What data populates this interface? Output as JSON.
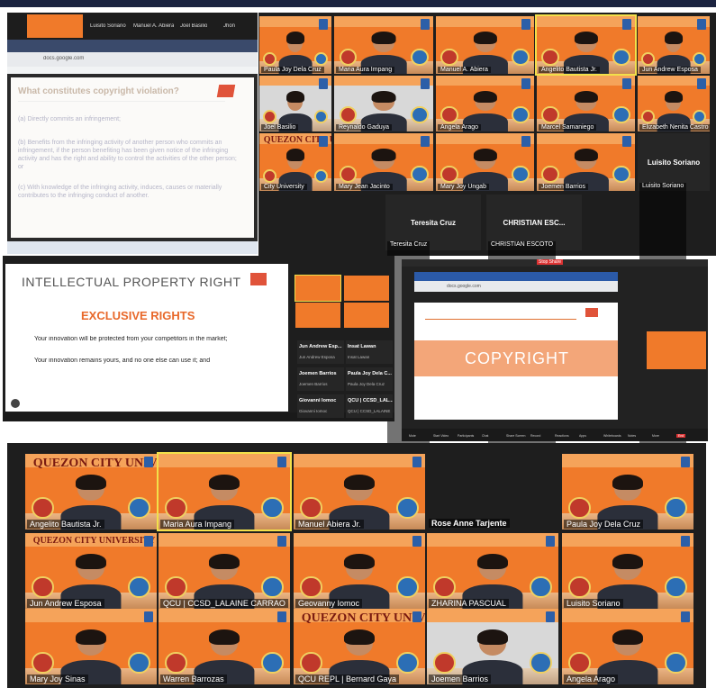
{
  "colors": {
    "orange": "#f07a2a",
    "dark": "#1e1e1e",
    "accent_blue": "#2c5fa8",
    "copyright_band": "#f3a679",
    "slide_red": "#e0533a"
  },
  "top_left_window": {
    "browser_url": "docs.google.com",
    "heading": "What constitutes copyright violation?",
    "items": [
      "(a) Directly commits an infringement;",
      "(b) Benefits from the infringing activity of another person who commits an infringement, if the person benefiting has been given notice of the infringing activity and has the right and ability to control the activities of the other person; or",
      "(c) With knowledge of the infringing activity, induces, causes or materially contributes to the infringing conduct of another."
    ],
    "top_strip_names": [
      "Luisito Soriano",
      "Manuel A. Abiera",
      "Joel Basilio",
      "Jhon"
    ]
  },
  "top_right_grid": {
    "university": "QUEZON CITY UNIVERSITY",
    "tiles": [
      {
        "name": "Paula Joy Dela Cruz"
      },
      {
        "name": "Maria Aura Impang"
      },
      {
        "name": "Manuel A. Abiera"
      },
      {
        "name": "Angelito Bautista Jr."
      },
      {
        "name": "Jun Andrew Esposa"
      },
      {
        "name": "Joel Basilio"
      },
      {
        "name": "Reynaldo Gaduya"
      },
      {
        "name": "Angela Arago"
      },
      {
        "name": "Marcel Samaniego"
      },
      {
        "name": "Elizabeth Nenita Castro"
      },
      {
        "name": "City University"
      },
      {
        "name": "Mary Jean Jacinto"
      },
      {
        "name": "Mary Joy Ungab"
      },
      {
        "name": "Joemen Barrios"
      },
      {
        "name": "Luisito Soriano"
      },
      {
        "name": "Teresita Cruz"
      },
      {
        "name": "CHRISTIAN ESCOTO"
      }
    ],
    "dark_tiles": [
      {
        "label": "Luisito Soriano",
        "name": "Luisito Soriano"
      },
      {
        "label": "Teresita Cruz",
        "name": "Teresita Cruz"
      },
      {
        "label": "CHRISTIAN ESC...",
        "name": "CHRISTIAN ESCOTO"
      }
    ]
  },
  "middle_left_slide": {
    "title": "INTELLECTUAL PROPERTY RIGHT",
    "subtitle": "EXCLUSIVE RIGHTS",
    "line1": "Your innovation will be protected from your competitors in the market;",
    "line2": "Your innovation remains yours, and no one else can use it; and"
  },
  "middle_side_panel": {
    "participants": [
      {
        "label": "Jun Andrew Esp...",
        "name": "Jun Andrew Esposa"
      },
      {
        "label": "Insat Lawan",
        "name": "Insat Lawan"
      },
      {
        "label": "Joemen Barrios",
        "name": "Joemen Barrios"
      },
      {
        "label": "Paula Joy Dela C...",
        "name": "Paula Joy Dela Cruz"
      },
      {
        "label": "Giovanni Iomoc",
        "name": "Giovanni Iomoc"
      },
      {
        "label": "QCU | CCSD_LAL...",
        "name": "QCU | CCSD_LALAINE"
      }
    ]
  },
  "middle_right_window": {
    "url": "docs.google.com",
    "share_label": "Stop Share",
    "slide_word": "COPYRIGHT",
    "toolbar_items": [
      "Mute",
      "Start Video",
      "Participants",
      "Chat",
      "Share Screen",
      "Record",
      "Reactions",
      "Apps",
      "Whiteboards",
      "Notes",
      "More",
      "End"
    ]
  },
  "bottom_grid": {
    "university": "QUEZON CITY UNIVERSITY",
    "tiles": [
      {
        "name": "Angelito Bautista Jr."
      },
      {
        "name": "Maria Aura Impang"
      },
      {
        "name": "Manuel Abiera Jr."
      },
      {
        "name": "Rose Anne Tarjente"
      },
      {
        "name": "Paula Joy Dela Cruz"
      },
      {
        "name": "Jun Andrew Esposa"
      },
      {
        "name": "QCU | CCSD_LALAINE CARRAO"
      },
      {
        "name": "Geovanny Iomoc"
      },
      {
        "name": "ZHARINA PASCUAL"
      },
      {
        "name": "Luisito Soriano"
      },
      {
        "name": "Mary Joy Sinas"
      },
      {
        "name": "Warren Barrozas"
      },
      {
        "name": "QCU REPL | Bernard Gaya"
      },
      {
        "name": "Joemen Barrios"
      },
      {
        "name": "Angela Arago"
      }
    ]
  }
}
